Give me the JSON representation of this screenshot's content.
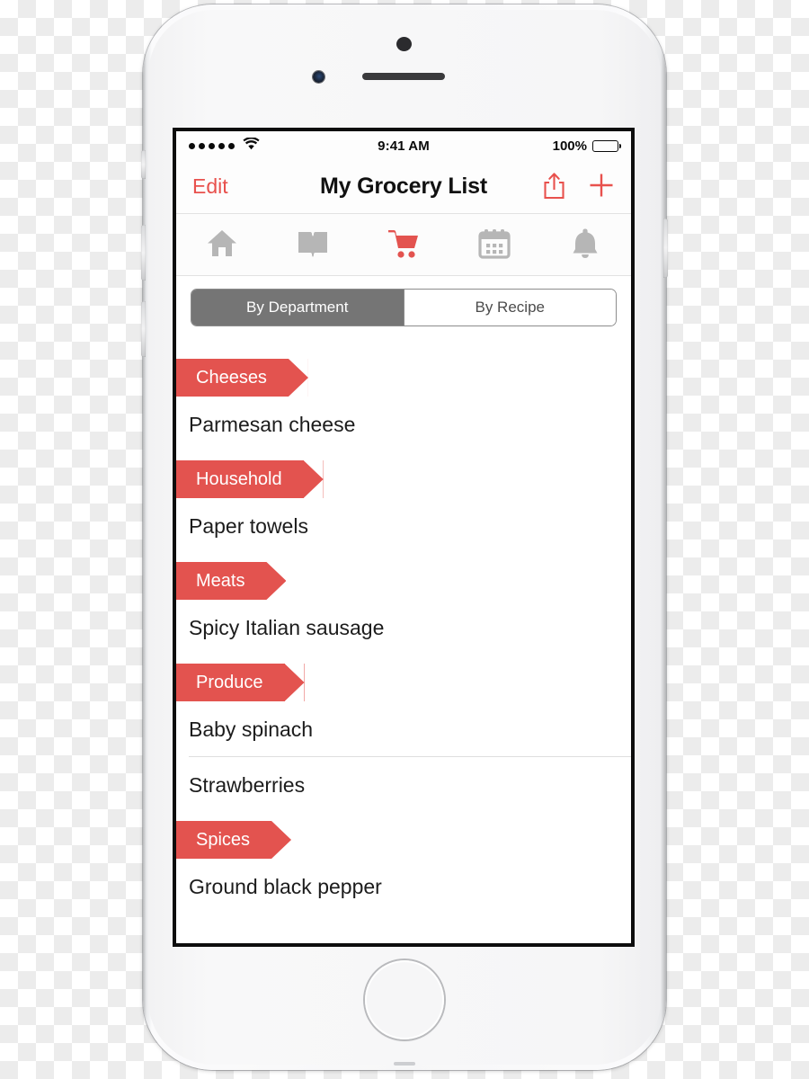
{
  "device": {
    "frame_label": "iphone-white-silver"
  },
  "status_bar": {
    "signal_dots": 5,
    "wifi": "wifi-icon",
    "time": "9:41 AM",
    "battery_percent": "100%"
  },
  "nav_bar": {
    "edit_label": "Edit",
    "title": "My Grocery List",
    "share_icon": "share-icon",
    "add_icon": "plus-icon"
  },
  "tab_bar": {
    "active_index": 2,
    "active_color": "#e3534f",
    "inactive_color": "#b3b3b3",
    "items": [
      {
        "name": "home",
        "icon": "home-icon"
      },
      {
        "name": "recipes",
        "icon": "book-icon"
      },
      {
        "name": "grocery-list",
        "icon": "shopping-cart-icon"
      },
      {
        "name": "planner",
        "icon": "calendar-icon"
      },
      {
        "name": "reminders",
        "icon": "bell-icon"
      }
    ]
  },
  "segmented_control": {
    "selected_index": 0,
    "options": [
      {
        "label": "By Department"
      },
      {
        "label": "By Recipe"
      }
    ]
  },
  "list": {
    "sections": [
      {
        "header": "Cheeses",
        "items": [
          {
            "label": "Parmesan cheese",
            "separator": false
          }
        ]
      },
      {
        "header": "Household",
        "items": [
          {
            "label": "Paper towels",
            "separator": false
          }
        ]
      },
      {
        "header": "Meats",
        "items": [
          {
            "label": "Spicy Italian sausage",
            "separator": false
          }
        ]
      },
      {
        "header": "Produce",
        "items": [
          {
            "label": "Baby spinach",
            "separator": true
          },
          {
            "label": "Strawberries",
            "separator": false
          }
        ]
      },
      {
        "header": "Spices",
        "items": [
          {
            "label": "Ground black pepper",
            "separator": false
          }
        ]
      }
    ]
  },
  "colors": {
    "accent_red": "#e3534f",
    "segment_selected": "#757575",
    "text_primary": "#1c1c1c",
    "separator": "#dedede"
  }
}
